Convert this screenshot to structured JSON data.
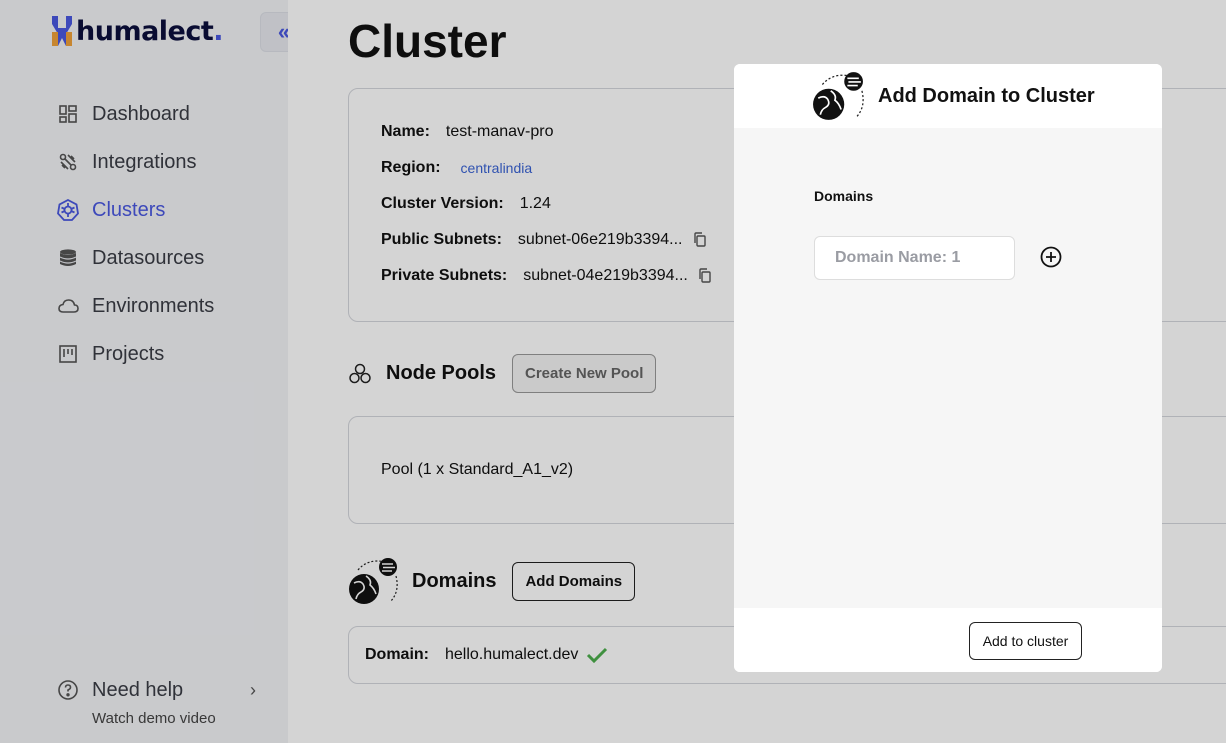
{
  "brand": {
    "name": "humalect",
    "dot": ".",
    "accent": "#4a58e0"
  },
  "sidebar": {
    "collapse_label": "«",
    "items": [
      {
        "label": "Dashboard",
        "icon": "dashboard-icon"
      },
      {
        "label": "Integrations",
        "icon": "integrations-icon"
      },
      {
        "label": "Clusters",
        "icon": "kubernetes-icon",
        "active": true
      },
      {
        "label": "Datasources",
        "icon": "database-icon"
      },
      {
        "label": "Environments",
        "icon": "cloud-icon"
      },
      {
        "label": "Projects",
        "icon": "board-icon"
      }
    ],
    "help": {
      "label": "Need help",
      "sub": "Watch demo video"
    }
  },
  "main": {
    "title": "Cluster",
    "info": {
      "name_label": "Name:",
      "name_value": "test-manav-pro",
      "region_label": "Region:",
      "region_value": "centralindia",
      "version_label": "Cluster Version:",
      "version_value": "1.24",
      "public_label": "Public Subnets:",
      "public_value": "subnet-06e219b3394...",
      "private_label": "Private Subnets:",
      "private_value": "subnet-04e219b3394..."
    },
    "node_pools": {
      "title": "Node Pools",
      "button": "Create New Pool",
      "pool": "Pool (1 x Standard_A1_v2)"
    },
    "domains": {
      "title": "Domains",
      "button": "Add Domains",
      "domain_label": "Domain:",
      "domain_value": "hello.humalect.dev"
    }
  },
  "modal": {
    "title": "Add Domain to Cluster",
    "domains_label": "Domains",
    "input_placeholder": "Domain Name: 1",
    "submit": "Add to cluster"
  }
}
